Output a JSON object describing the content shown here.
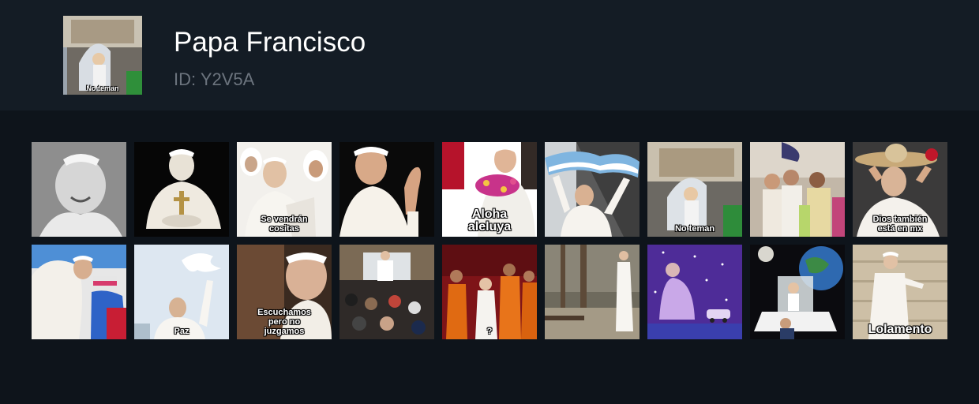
{
  "pack": {
    "title": "Papa Francisco",
    "id_label": "ID: Y2V5A",
    "cover_caption": "No teman"
  },
  "stickers": [
    {
      "name": "sticker-smiling-bw",
      "caption": ""
    },
    {
      "name": "sticker-praying-dark",
      "caption": ""
    },
    {
      "name": "sticker-se-vendran-cositas",
      "caption": "Se vendrán\ncositas"
    },
    {
      "name": "sticker-waving",
      "caption": ""
    },
    {
      "name": "sticker-aloha-aleluya",
      "caption": "Aloha\naleluya"
    },
    {
      "name": "sticker-flag",
      "caption": ""
    },
    {
      "name": "sticker-no-teman",
      "caption": "No teman"
    },
    {
      "name": "sticker-crowd",
      "caption": ""
    },
    {
      "name": "sticker-dios-tambien-esta-en-mx",
      "caption": "Dios también\nestá en mx"
    },
    {
      "name": "sticker-hat",
      "caption": ""
    },
    {
      "name": "sticker-paz",
      "caption": "Paz"
    },
    {
      "name": "sticker-escuchamos-pero-no-juzgamos",
      "caption": "Escuchamos\npero no\njuzgamos"
    },
    {
      "name": "sticker-popemobile-crowd",
      "caption": ""
    },
    {
      "name": "sticker-monks",
      "caption": "?"
    },
    {
      "name": "sticker-standing",
      "caption": ""
    },
    {
      "name": "sticker-space-purple",
      "caption": ""
    },
    {
      "name": "sticker-moon-car",
      "caption": ""
    },
    {
      "name": "sticker-lolamento",
      "caption": "Lolamento"
    }
  ]
}
